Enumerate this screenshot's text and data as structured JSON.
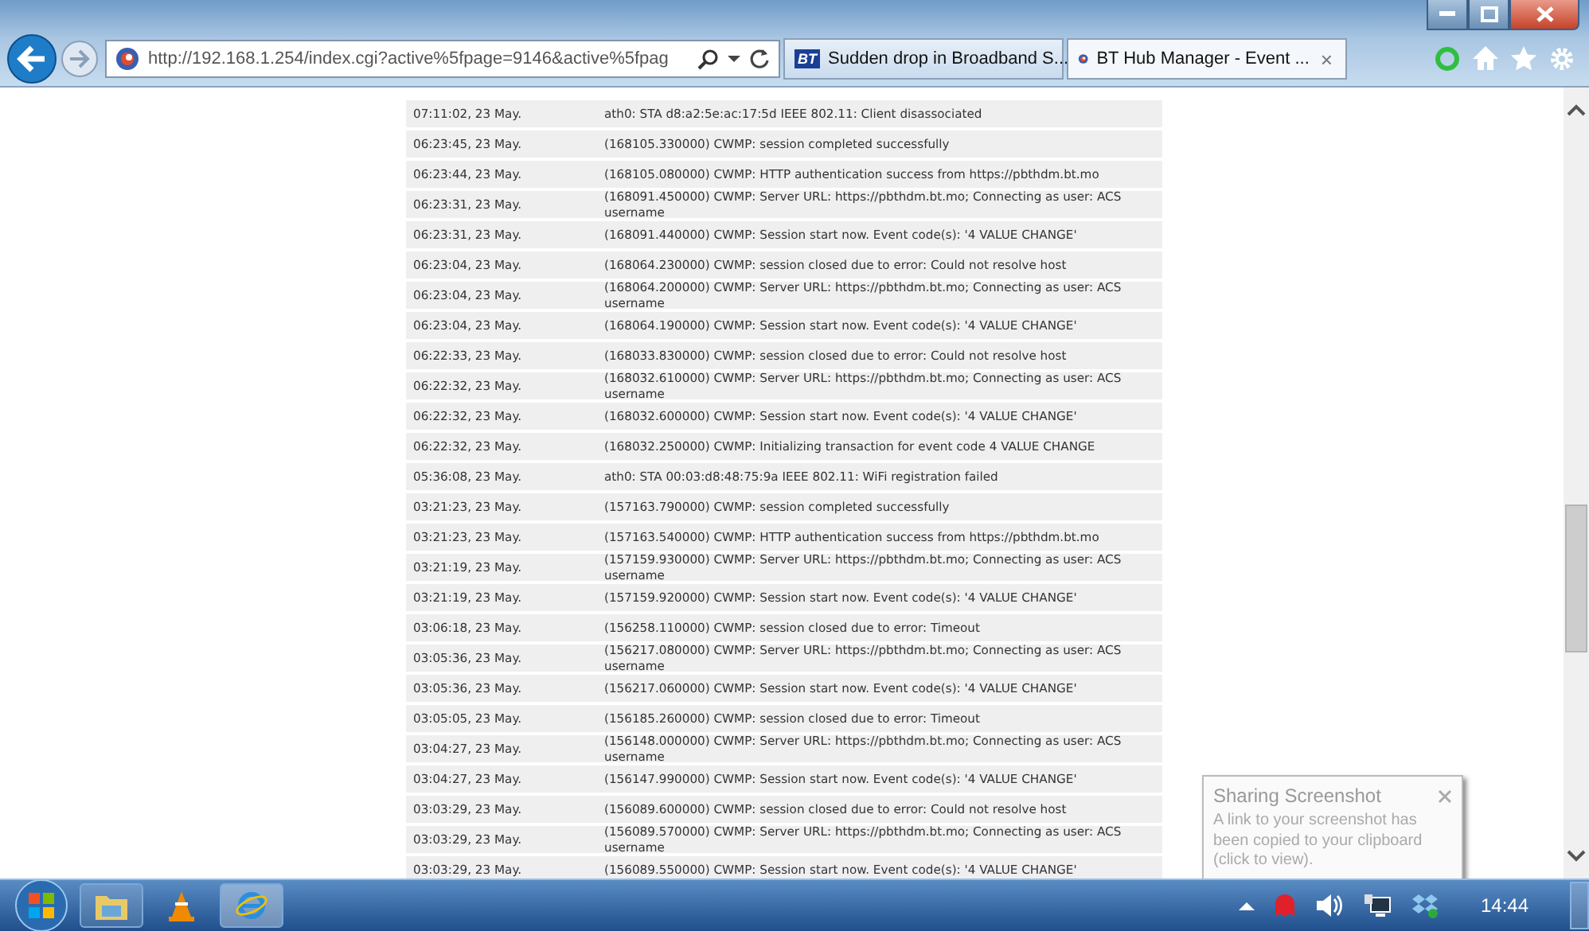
{
  "browser": {
    "address_bar": {
      "value": "http://192.168.1.254/index.cgi?active%5fpage=9146&active%5fpag"
    },
    "tabs": [
      {
        "title": "Sudden drop in Broadband S...",
        "selected": false,
        "logo": "BT"
      },
      {
        "title": "BT Hub Manager - Event ...",
        "selected": true,
        "close": "×"
      }
    ]
  },
  "event_log": {
    "rows": [
      {
        "time": "07:11:02, 23 May.",
        "message": "ath0: STA d8:a2:5e:ac:17:5d IEEE 802.11: Client disassociated"
      },
      {
        "time": "06:23:45, 23 May.",
        "message": "(168105.330000) CWMP: session completed successfully"
      },
      {
        "time": "06:23:44, 23 May.",
        "message": "(168105.080000) CWMP: HTTP authentication success from https://pbthdm.bt.mo"
      },
      {
        "time": "06:23:31, 23 May.",
        "message": "(168091.450000) CWMP: Server URL: https://pbthdm.bt.mo; Connecting as user: ACS username"
      },
      {
        "time": "06:23:31, 23 May.",
        "message": "(168091.440000) CWMP: Session start now. Event code(s): '4 VALUE CHANGE'"
      },
      {
        "time": "06:23:04, 23 May.",
        "message": "(168064.230000) CWMP: session closed due to error: Could not resolve host"
      },
      {
        "time": "06:23:04, 23 May.",
        "message": "(168064.200000) CWMP: Server URL: https://pbthdm.bt.mo; Connecting as user: ACS username"
      },
      {
        "time": "06:23:04, 23 May.",
        "message": "(168064.190000) CWMP: Session start now. Event code(s): '4 VALUE CHANGE'"
      },
      {
        "time": "06:22:33, 23 May.",
        "message": "(168033.830000) CWMP: session closed due to error: Could not resolve host"
      },
      {
        "time": "06:22:32, 23 May.",
        "message": "(168032.610000) CWMP: Server URL: https://pbthdm.bt.mo; Connecting as user: ACS username"
      },
      {
        "time": "06:22:32, 23 May.",
        "message": "(168032.600000) CWMP: Session start now. Event code(s): '4 VALUE CHANGE'"
      },
      {
        "time": "06:22:32, 23 May.",
        "message": "(168032.250000) CWMP: Initializing transaction for event code 4 VALUE CHANGE"
      },
      {
        "time": "05:36:08, 23 May.",
        "message": "ath0: STA 00:03:d8:48:75:9a IEEE 802.11: WiFi registration failed"
      },
      {
        "time": "03:21:23, 23 May.",
        "message": "(157163.790000) CWMP: session completed successfully"
      },
      {
        "time": "03:21:23, 23 May.",
        "message": "(157163.540000) CWMP: HTTP authentication success from https://pbthdm.bt.mo"
      },
      {
        "time": "03:21:19, 23 May.",
        "message": "(157159.930000) CWMP: Server URL: https://pbthdm.bt.mo; Connecting as user: ACS username"
      },
      {
        "time": "03:21:19, 23 May.",
        "message": "(157159.920000) CWMP: Session start now. Event code(s): '4 VALUE CHANGE'"
      },
      {
        "time": "03:06:18, 23 May.",
        "message": "(156258.110000) CWMP: session closed due to error: Timeout"
      },
      {
        "time": "03:05:36, 23 May.",
        "message": "(156217.080000) CWMP: Server URL: https://pbthdm.bt.mo; Connecting as user: ACS username"
      },
      {
        "time": "03:05:36, 23 May.",
        "message": "(156217.060000) CWMP: Session start now. Event code(s): '4 VALUE CHANGE'"
      },
      {
        "time": "03:05:05, 23 May.",
        "message": "(156185.260000) CWMP: session closed due to error: Timeout"
      },
      {
        "time": "03:04:27, 23 May.",
        "message": "(156148.000000) CWMP: Server URL: https://pbthdm.bt.mo; Connecting as user: ACS username"
      },
      {
        "time": "03:04:27, 23 May.",
        "message": "(156147.990000) CWMP: Session start now. Event code(s): '4 VALUE CHANGE'"
      },
      {
        "time": "03:03:29, 23 May.",
        "message": "(156089.600000) CWMP: session closed due to error: Could not resolve host"
      },
      {
        "time": "03:03:29, 23 May.",
        "message": "(156089.570000) CWMP: Server URL: https://pbthdm.bt.mo; Connecting as user: ACS username"
      },
      {
        "time": "03:03:29, 23 May.",
        "message": "(156089.550000) CWMP: Session start now. Event code(s): '4 VALUE CHANGE'"
      }
    ]
  },
  "notification": {
    "title": "Sharing Screenshot",
    "body": "A link to your screenshot has been copied to your clipboard (click to view)."
  },
  "taskbar": {
    "clock": "14:44"
  }
}
